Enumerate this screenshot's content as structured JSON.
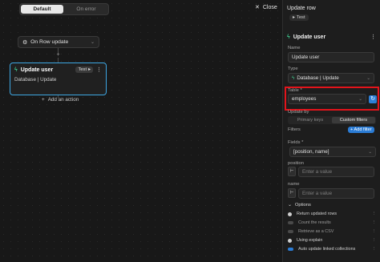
{
  "canvas": {
    "tabs": [
      {
        "label": "Default",
        "active": true
      },
      {
        "label": "On error",
        "active": false
      }
    ],
    "trigger_node": {
      "label": "On Row update"
    },
    "action_node": {
      "title": "Update user",
      "test_label": "Test",
      "subtitle": "Database | Update"
    },
    "add_action_label": "Add an action"
  },
  "close_label": "Close",
  "panel": {
    "title": "Update row",
    "badge": "Test",
    "card_title": "Update user",
    "name_label": "Name",
    "name_value": "Update user",
    "type_label": "Type",
    "type_value": "Database | Update",
    "table_label": "Table *",
    "table_value": "employees",
    "update_by_label": "Update by",
    "update_by_options": [
      "Primary keys",
      "Custom filters"
    ],
    "filters_label": "Filters",
    "add_filter_label": "+ Add filter",
    "fields_label": "Fields *",
    "fields_value": "[position, name]",
    "position_label": "position",
    "position_placeholder": "Enter a value",
    "name_field_label": "name",
    "name_field_placeholder": "Enter a value",
    "options_label": "Options",
    "options": [
      {
        "label": "Return updated rows",
        "enabled": true
      },
      {
        "label": "Count the results",
        "enabled": false
      },
      {
        "label": "Retrieve as a CSV",
        "enabled": false
      },
      {
        "label": "Using explain",
        "enabled": true
      },
      {
        "label": "Auto update linked collections",
        "enabled": true
      }
    ]
  },
  "colors": {
    "accent": "#2b7cd5",
    "selection_border": "#3ea7e3",
    "highlight": "#e3141b"
  }
}
